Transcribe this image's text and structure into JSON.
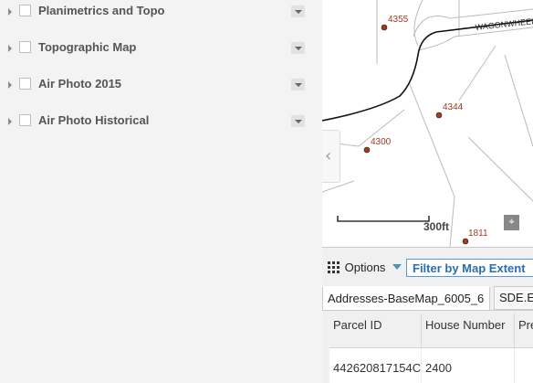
{
  "layers": [
    {
      "label": "Planimetrics and Topo"
    },
    {
      "label": "Topographic Map"
    },
    {
      "label": "Air Photo 2015"
    },
    {
      "label": "Air Photo Historical"
    }
  ],
  "map": {
    "road_label": "WAGONWHEEL",
    "address_points": [
      {
        "label": "4355"
      },
      {
        "label": "4344"
      },
      {
        "label": "4300"
      },
      {
        "label": "1811"
      }
    ],
    "scale_label": "300ft",
    "point_color": "#a33a1a"
  },
  "table": {
    "options_label": "Options",
    "filter_label": "Filter by Map Extent",
    "tabs": [
      "Addresses-BaseMap_6005_6",
      "SDE.E"
    ],
    "columns": [
      "Parcel ID",
      "House Number",
      "Pre"
    ],
    "rows": [
      [
        "442620817154C",
        "2400",
        ""
      ]
    ]
  }
}
